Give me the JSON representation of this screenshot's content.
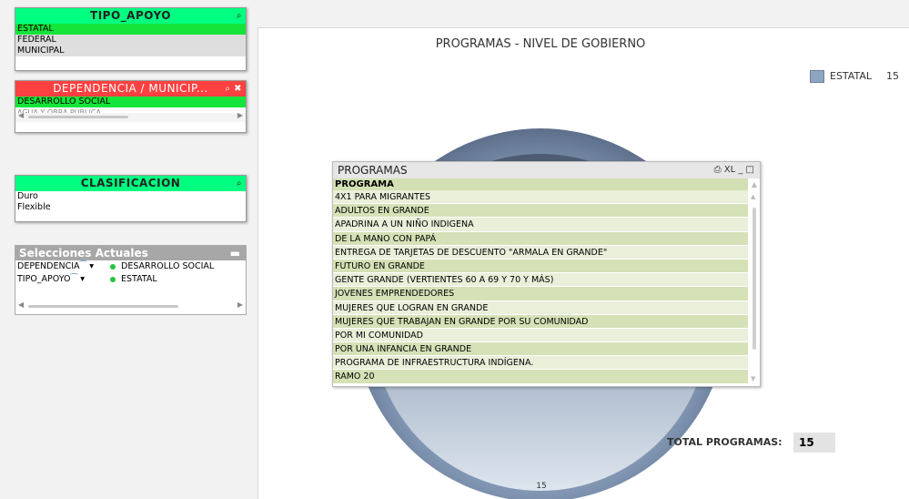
{
  "tipo_apoyo": {
    "caption": "TIPO_APOYO",
    "items": [
      "ESTATAL",
      "FEDERAL",
      "MUNICIPAL"
    ],
    "selected_index": 0,
    "accent": "#00ff80"
  },
  "dependencia": {
    "caption": "DEPENDENCIA  /  MUNICIP...",
    "items": [
      "DESARROLLO SOCIAL",
      "AGUA Y OBRA PÚBLICA"
    ],
    "accent": "#ff4040"
  },
  "clasificacion": {
    "caption": "CLASIFICACION",
    "items": [
      "Duro",
      "Flexible"
    ],
    "accent": "#00ff80"
  },
  "selecciones": {
    "caption": "Selecciones Actuales",
    "rows": [
      {
        "field": "DEPENDENCIA",
        "value": "DESARROLLO SOCIAL"
      },
      {
        "field": "TIPO_APOYO",
        "value": "ESTATAL"
      }
    ]
  },
  "chart_data": {
    "type": "pie",
    "title": "PROGRAMAS - NIVEL DE GOBIERNO",
    "categories": [
      "ESTATAL"
    ],
    "values": [
      15
    ],
    "slice_label": "15",
    "legend_value": "15",
    "legend_position": "top-right",
    "colors": [
      "#8ea5c1"
    ]
  },
  "programas": {
    "caption": "PROGRAMAS",
    "header_icons": "⎙ XL _ □",
    "column": "PROGRAMA",
    "rows": [
      "4X1 PARA MIGRANTES",
      "ADULTOS EN GRANDE",
      "APADRINA A UN NIÑO INDIGENA",
      "DE LA MANO CON PAPÁ",
      "ENTREGA DE TARJETAS DE DESCUENTO \"ARMALA EN GRANDE\"",
      "FUTURO EN GRANDE",
      "GENTE GRANDE  (VERTIENTES 60 A 69 Y 70 Y  MÁS)",
      "JOVENES EMPRENDEDORES",
      "MUJERES QUE LOGRAN EN GRANDE",
      "MUJERES QUE TRABAJAN EN GRANDE POR SU COMUNIDAD",
      "POR MI COMUNIDAD",
      "POR UNA INFANCIA EN GRANDE",
      "PROGRAMA DE INFRAESTRUCTURA INDÍGENA.",
      "RAMO 20"
    ]
  },
  "total": {
    "label": "TOTAL PROGRAMAS:",
    "value": "15"
  }
}
